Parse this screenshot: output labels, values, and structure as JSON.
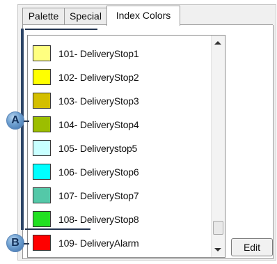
{
  "tabs": [
    {
      "label": "Palette"
    },
    {
      "label": "Special"
    },
    {
      "label": "Index Colors",
      "active": true
    }
  ],
  "colors": [
    {
      "label": "101- DeliveryStop1",
      "color": "#ffff80"
    },
    {
      "label": "102- DeliveryStop2",
      "color": "#ffff00"
    },
    {
      "label": "103- DeliveryStop3",
      "color": "#d4bf00"
    },
    {
      "label": "104- DeliveryStop4",
      "color": "#9cbe00"
    },
    {
      "label": "105- Deliverystop5",
      "color": "#c8ffff"
    },
    {
      "label": "106- DeliveryStop6",
      "color": "#00ffff"
    },
    {
      "label": "107- DeliveryStop7",
      "color": "#54c8a8"
    },
    {
      "label": "108- DeliveryStop8",
      "color": "#22e022"
    },
    {
      "label": "109- DeliveryAlarm",
      "color": "#ff0000"
    }
  ],
  "edit_button": {
    "label": "Edit"
  },
  "callouts": {
    "a": "A",
    "b": "B"
  },
  "accent": "#23344f"
}
